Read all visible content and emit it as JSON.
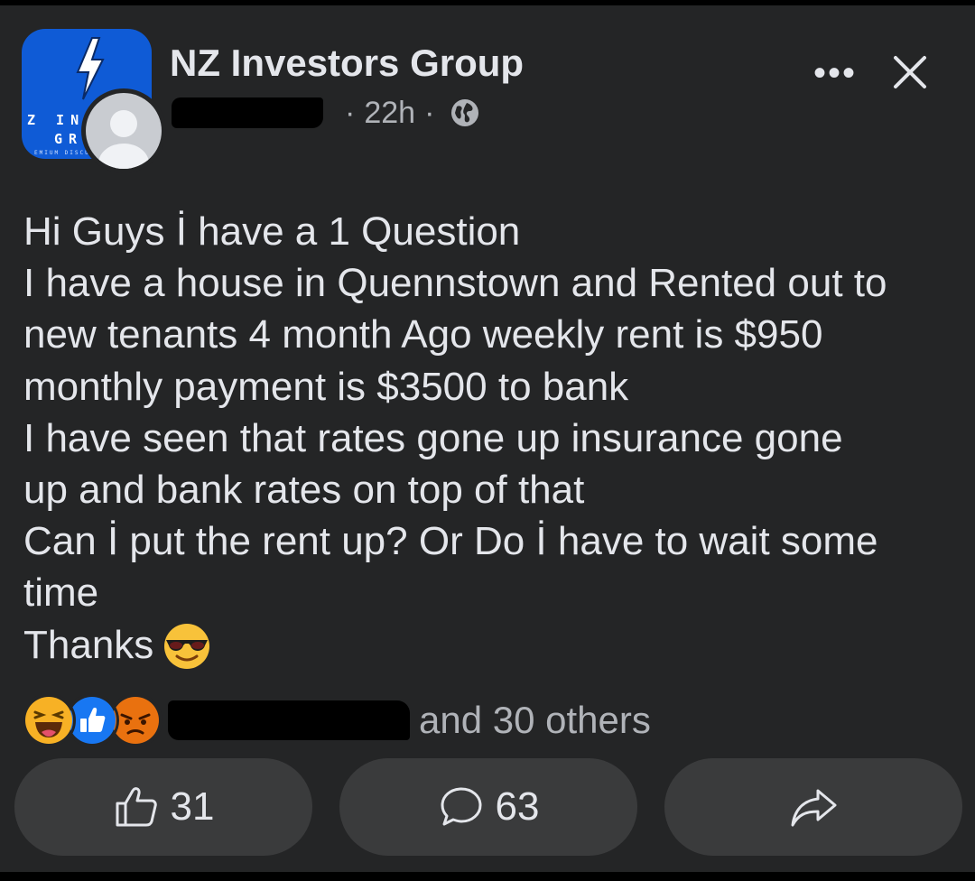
{
  "post": {
    "group_name": "NZ Investors Group",
    "group_logo": {
      "line1": "Z INV",
      "line2": "GR",
      "line3": "EMIUM DISCU"
    },
    "time": "22h",
    "meta_separator": "·",
    "privacy_icon": "globe-icon",
    "more_label": "•••",
    "close_icon": "close-icon",
    "body_lines": [
      "Hi Guys İ have a 1 Question",
      "I have a house in Quennstown and Rented out to",
      "new tenants 4 month Ago weekly rent is $950",
      "monthly payment is $3500 to bank",
      "I have seen that rates gone up insurance gone",
      "up and bank rates on top of that",
      "Can İ put the rent up? Or Do İ have to wait some",
      "time",
      "Thanks"
    ],
    "reactions": {
      "icons": [
        "haha-reaction-icon",
        "like-reaction-icon",
        "angry-reaction-icon"
      ],
      "summary": "and 30 others"
    },
    "actions": {
      "like_count": "31",
      "comment_count": "63",
      "share_icon": "share-icon"
    },
    "colors": {
      "background": "#242526",
      "button": "#3a3b3c",
      "text": "#e4e6eb",
      "secondary_text": "#b0b3b8",
      "like_blue": "#1877f2",
      "haha_yellow": "#f7b125",
      "angry_orange": "#e9710f"
    }
  }
}
